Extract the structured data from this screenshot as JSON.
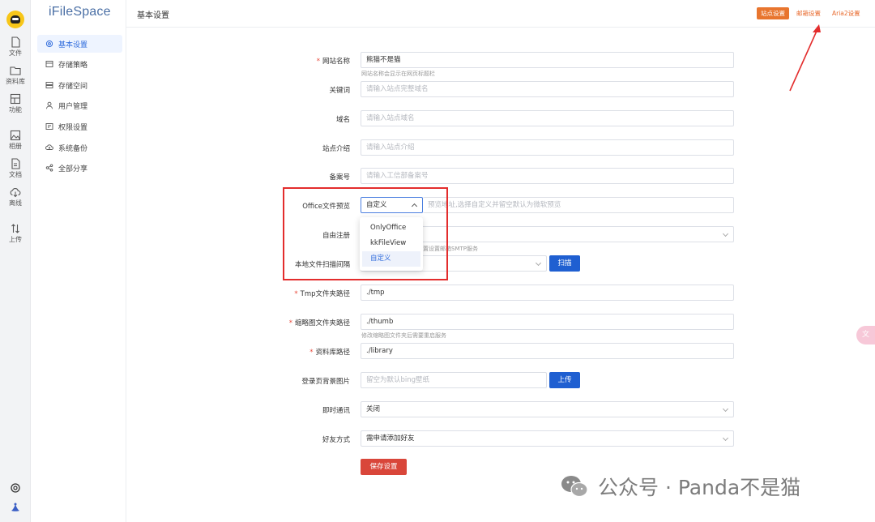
{
  "app": {
    "name": "iFileSpace"
  },
  "rail": [
    {
      "label": "文件",
      "icon": "file-icon"
    },
    {
      "label": "资料库",
      "icon": "folder-icon"
    },
    {
      "label": "功能",
      "icon": "grid-icon"
    },
    {
      "label": "相册",
      "icon": "image-icon"
    },
    {
      "label": "文档",
      "icon": "document-icon"
    },
    {
      "label": "离线",
      "icon": "cloud-download-icon"
    },
    {
      "label": "上传",
      "icon": "upload-icon"
    }
  ],
  "sidebar": {
    "items": [
      {
        "label": "基本设置",
        "icon": "gear-icon",
        "active": true
      },
      {
        "label": "存储策略",
        "icon": "strategy-icon"
      },
      {
        "label": "存储空间",
        "icon": "storage-icon"
      },
      {
        "label": "用户管理",
        "icon": "user-icon"
      },
      {
        "label": "权限设置",
        "icon": "permission-icon"
      },
      {
        "label": "系统备份",
        "icon": "backup-icon"
      },
      {
        "label": "全部分享",
        "icon": "share-icon"
      }
    ]
  },
  "header": {
    "title": "基本设置",
    "tabs": [
      "站点设置",
      "邮箱设置",
      "Aria2设置"
    ]
  },
  "form": {
    "site_name": {
      "label": "网站名称",
      "value": "熊猫不是猫",
      "hint": "网站名称会显示在网页标题栏"
    },
    "keywords": {
      "label": "关键词",
      "placeholder": "请输入站点完整域名"
    },
    "domain": {
      "label": "域名",
      "placeholder": "请输入站点域名"
    },
    "intro": {
      "label": "站点介绍",
      "placeholder": "请输入站点介绍"
    },
    "icp": {
      "label": "备案号",
      "placeholder": "请输入工信部备案号"
    },
    "office_preview": {
      "label": "Office文件预览",
      "value": "自定义",
      "placeholder": "预览地址,选择自定义并留空默认为微软预览",
      "options": [
        "OnlyOffice",
        "kkFileView",
        "自定义"
      ]
    },
    "free_register": {
      "label": "自由注册",
      "hint": "置设置邮箱SMTP服务"
    },
    "scan_interval": {
      "label": "本地文件扫描间隔",
      "button": "扫描"
    },
    "tmp_path": {
      "label": "Tmp文件夹路径",
      "value": "./tmp"
    },
    "thumb_path": {
      "label": "缩略图文件夹路径",
      "value": "./thumb",
      "hint": "修改缩略图文件夹后需要重启服务"
    },
    "library_path": {
      "label": "资料库路径",
      "value": "./library"
    },
    "login_bg": {
      "label": "登录页背景图片",
      "placeholder": "留空为默认bing壁纸",
      "button": "上传"
    },
    "im": {
      "label": "即时通讯",
      "value": "关闭"
    },
    "friend": {
      "label": "好友方式",
      "value": "需申请添加好友"
    },
    "save": "保存设置"
  },
  "watermark": {
    "text": "公众号 · Panda不是猫"
  },
  "colors": {
    "accent": "#1f5fd1",
    "tab_active": "#e8752e",
    "save": "#d9463a",
    "annotation": "#e32d2d"
  }
}
